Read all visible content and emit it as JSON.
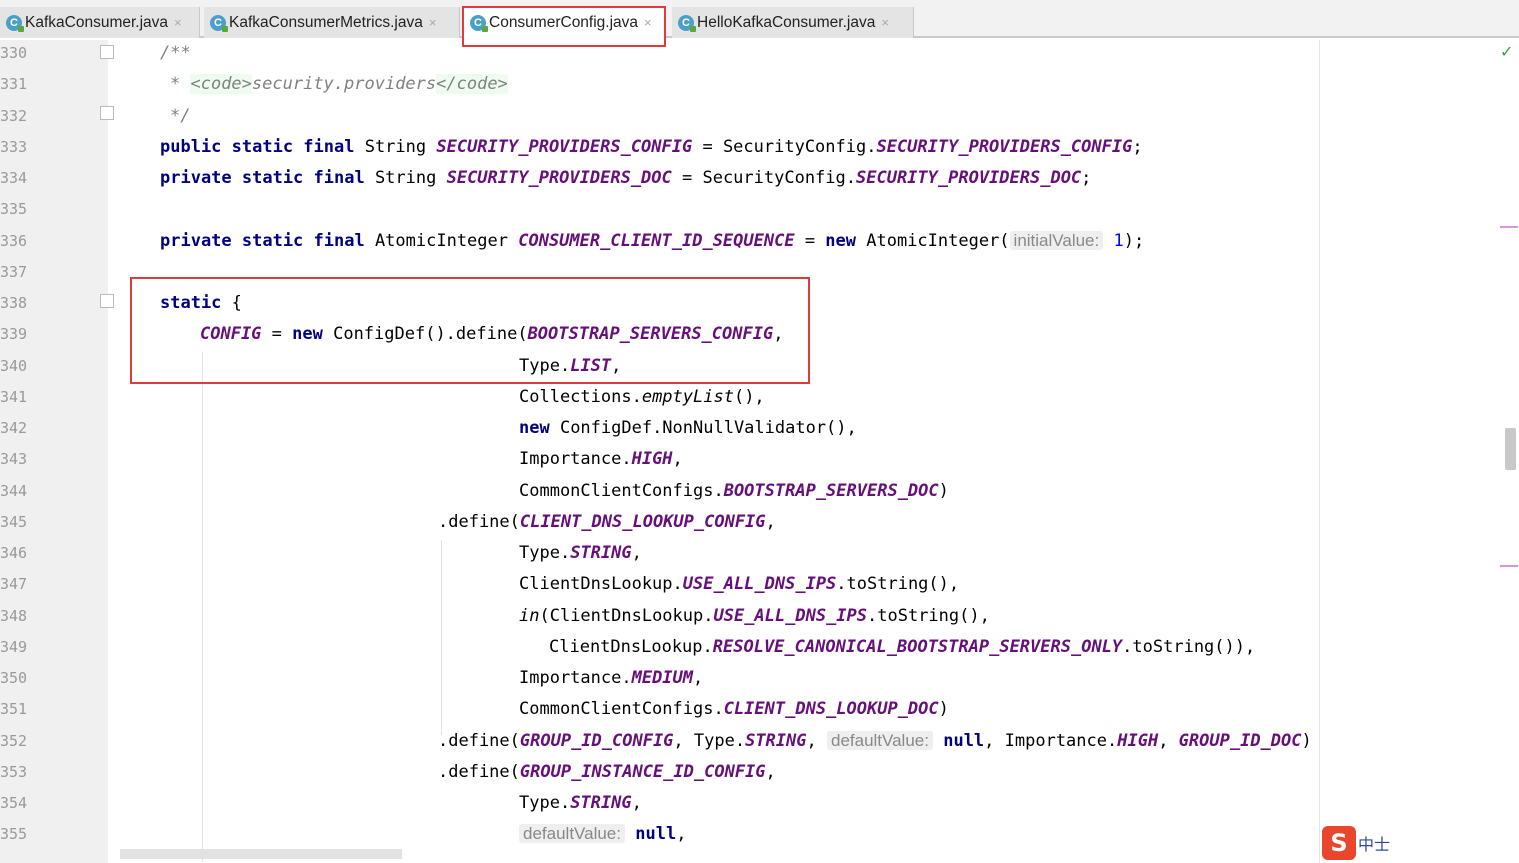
{
  "tabs": [
    {
      "label": "KafkaConsumer.java",
      "icon": "java-class-icon",
      "active": false
    },
    {
      "label": "KafkaConsumerMetrics.java",
      "icon": "java-class-icon",
      "active": false
    },
    {
      "label": "ConsumerConfig.java",
      "icon": "java-class-icon",
      "active": true
    },
    {
      "label": "HelloKafkaConsumer.java",
      "icon": "java-class-icon",
      "active": false
    }
  ],
  "close_glyph": "×",
  "line_numbers": [
    "330",
    "331",
    "332",
    "333",
    "334",
    "335",
    "336",
    "337",
    "338",
    "339",
    "340",
    "341",
    "342",
    "343",
    "344",
    "345",
    "346",
    "347",
    "348",
    "349",
    "350",
    "351",
    "352",
    "353",
    "354",
    "355"
  ],
  "code": {
    "l330": "/**",
    "l331_star": "* ",
    "l331_open": "<code>",
    "l331_text": "security.providers",
    "l331_close": "</code>",
    "l332": "*/",
    "l333_mod": "public static final",
    "l333_type": " String ",
    "l333_const": "SECURITY_PROVIDERS_CONFIG",
    "l333_mid": " = SecurityConfig.",
    "l333_const2": "SECURITY_PROVIDERS_CONFIG",
    "l333_end": ";",
    "l334_mod": "private static final",
    "l334_type": " String ",
    "l334_const": "SECURITY_PROVIDERS_DOC",
    "l334_mid": " = SecurityConfig.",
    "l334_const2": "SECURITY_PROVIDERS_DOC",
    "l334_end": ";",
    "l336_mod": "private static final",
    "l336_type": " AtomicInteger ",
    "l336_const": "CONSUMER_CLIENT_ID_SEQUENCE",
    "l336_eq": " = ",
    "l336_new": "new",
    "l336_ctor": " AtomicInteger(",
    "l336_hint": "initialValue:",
    "l336_num": "1",
    "l336_end": ");",
    "l338_kw": "static",
    "l338_brace": " {",
    "l339_const": "CONFIG",
    "l339_eq": " = ",
    "l339_new": "new",
    "l339_rest": " ConfigDef().define(",
    "l339_const2": "BOOTSTRAP_SERVERS_CONFIG",
    "l339_end": ",",
    "l340_pre": "Type.",
    "l340_const": "LIST",
    "l340_end": ",",
    "l341_pre": "Collections.",
    "l341_method": "emptyList",
    "l341_end": "(),",
    "l342_new": "new",
    "l342_rest": " ConfigDef.NonNullValidator(),",
    "l343_pre": "Importance.",
    "l343_const": "HIGH",
    "l343_end": ",",
    "l344_pre": "CommonClientConfigs.",
    "l344_const": "BOOTSTRAP_SERVERS_DOC",
    "l344_end": ")",
    "l345_pre": ".define(",
    "l345_const": "CLIENT_DNS_LOOKUP_CONFIG",
    "l345_end": ",",
    "l346_pre": "Type.",
    "l346_const": "STRING",
    "l346_end": ",",
    "l347_pre": "ClientDnsLookup.",
    "l347_const": "USE_ALL_DNS_IPS",
    "l347_end": ".toString(),",
    "l348_in": "in",
    "l348_pre": "(ClientDnsLookup.",
    "l348_const": "USE_ALL_DNS_IPS",
    "l348_end": ".toString(),",
    "l349_pre": "ClientDnsLookup.",
    "l349_const": "RESOLVE_CANONICAL_BOOTSTRAP_SERVERS_ONLY",
    "l349_end": ".toString()),",
    "l350_pre": "Importance.",
    "l350_const": "MEDIUM",
    "l350_end": ",",
    "l351_pre": "CommonClientConfigs.",
    "l351_const": "CLIENT_DNS_LOOKUP_DOC",
    "l351_end": ")",
    "l352_pre": ".define(",
    "l352_const": "GROUP_ID_CONFIG",
    "l352_a": ", Type.",
    "l352_const2": "STRING",
    "l352_b": ", ",
    "l352_hint": "defaultValue:",
    "l352_null": "null",
    "l352_c": ", Importance.",
    "l352_const3": "HIGH",
    "l352_d": ", ",
    "l352_const4": "GROUP_ID_DOC",
    "l352_end": ")",
    "l353_pre": ".define(",
    "l353_const": "GROUP_INSTANCE_ID_CONFIG",
    "l353_end": ",",
    "l354_pre": "Type.",
    "l354_const": "STRING",
    "l354_end": ",",
    "l355_hint": "defaultValue:",
    "l355_null": "null",
    "l355_end": ","
  },
  "status": {
    "inspection_ok": "✓"
  },
  "watermark": {
    "logo": "S",
    "text": "中士"
  }
}
